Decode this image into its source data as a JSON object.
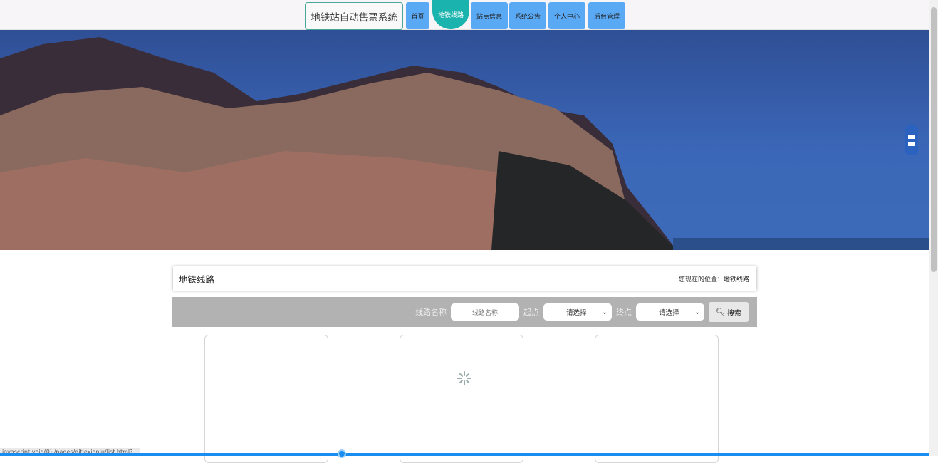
{
  "header": {
    "brand": "地铁站自动售票系统",
    "nav": [
      {
        "label": "首页"
      },
      {
        "label": "地铁线路",
        "active": true
      },
      {
        "label": "站点信息"
      },
      {
        "label": "系统公告"
      },
      {
        "label": "个人中心"
      },
      {
        "label": "后台管理"
      }
    ]
  },
  "page": {
    "title": "地铁线路",
    "breadcrumb": "您现在的位置：地铁线路"
  },
  "search": {
    "name_label": "线路名称",
    "name_placeholder": "线路名称",
    "start_label": "起点",
    "start_value": "请选择",
    "end_label": "终点",
    "end_value": "请选择",
    "button": "搜索"
  },
  "status_url": "javascript:void(0);/pages/ditiexianlu/list.html?",
  "colors": {
    "nav": "#5aa9f5",
    "active": "#1bb3ad",
    "accent": "#1a8ef0"
  }
}
